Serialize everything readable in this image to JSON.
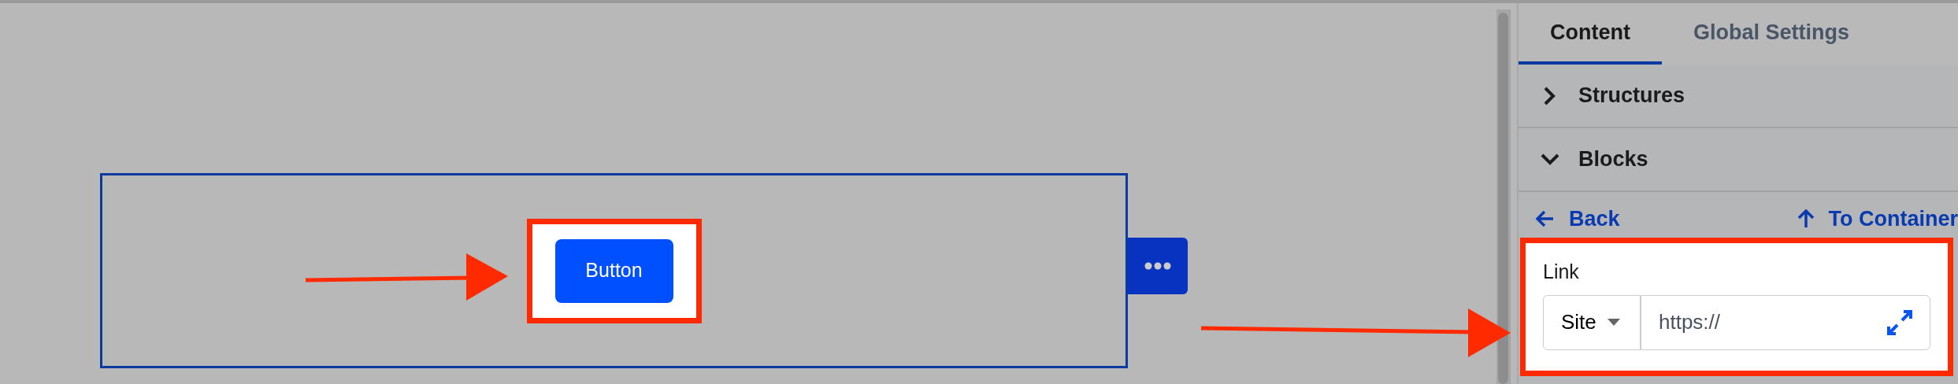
{
  "canvas": {
    "button": "Button"
  },
  "tabs": [
    {
      "label": "Content",
      "selected": true
    },
    {
      "label": "Global Settings",
      "selected": false
    }
  ],
  "sections": [
    {
      "label": "Structures",
      "expanded": false
    },
    {
      "label": "Blocks",
      "expanded": true
    }
  ],
  "nav": {
    "back": "Back",
    "to_container": "To Container"
  },
  "link_field": {
    "label": "Link",
    "type": "Site",
    "value": "https://"
  }
}
